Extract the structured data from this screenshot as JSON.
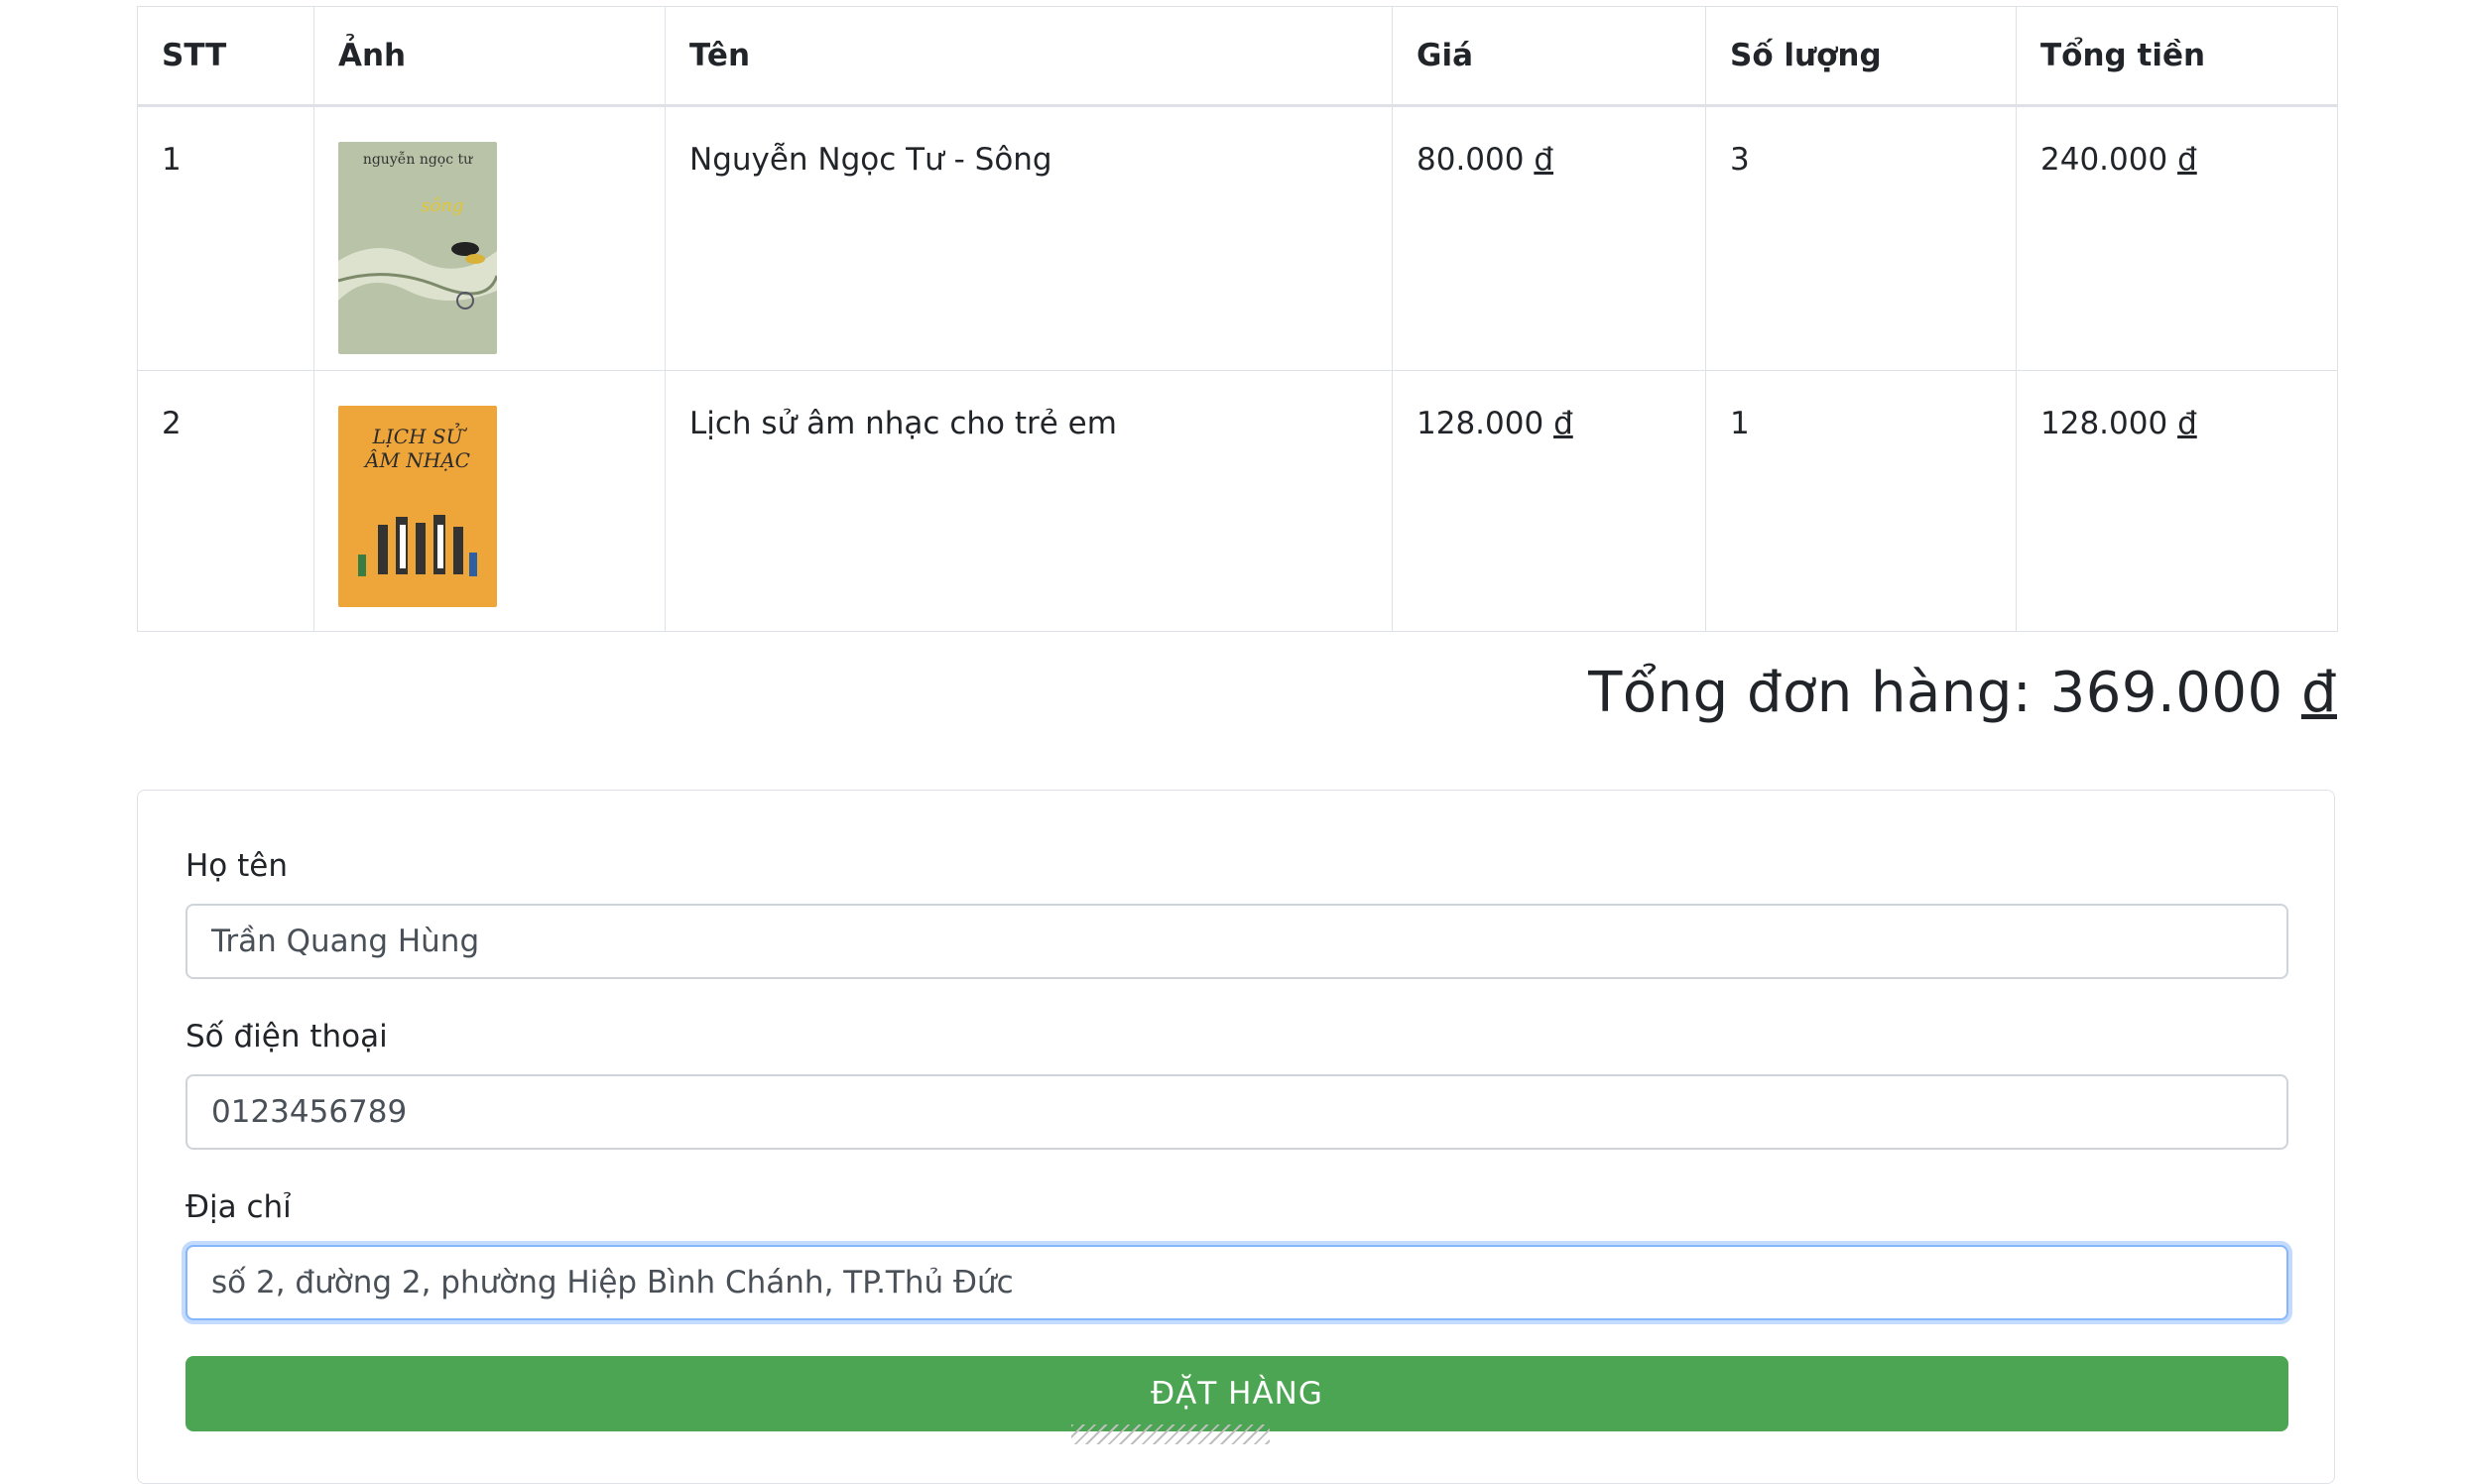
{
  "table": {
    "headers": [
      "STT",
      "Ảnh",
      "Tên",
      "Giá",
      "Số lượng",
      "Tổng tiền"
    ],
    "rows": [
      {
        "stt": "1",
        "cover_title": "nguyễn ngọc tư",
        "cover_subtitle": "sông",
        "name": "Nguyễn Ngọc Tư - Sông",
        "price": "80.000",
        "qty": "3",
        "total": "240.000"
      },
      {
        "stt": "2",
        "cover_title": "LỊCH SỬ",
        "cover_subtitle": "ÂM NHẠC",
        "name": "Lịch sử âm nhạc cho trẻ em",
        "price": "128.000",
        "qty": "1",
        "total": "128.000"
      }
    ],
    "currency": "đ"
  },
  "order_total": {
    "label": "Tổng đơn hàng: 369.000",
    "currency": "đ"
  },
  "form": {
    "name_label": "Họ tên",
    "name_value": "Trần Quang Hùng",
    "phone_label": "Số điện thoại",
    "phone_value": "0123456789",
    "address_label": "Địa chỉ",
    "address_value": "số 2, đường 2, phường Hiệp Bình Chánh, TP.Thủ Đức",
    "submit_label": "ĐẶT HÀNG"
  },
  "colors": {
    "button": "#4ca552",
    "border": "#dee2e6",
    "focus": "#86b7fe"
  }
}
